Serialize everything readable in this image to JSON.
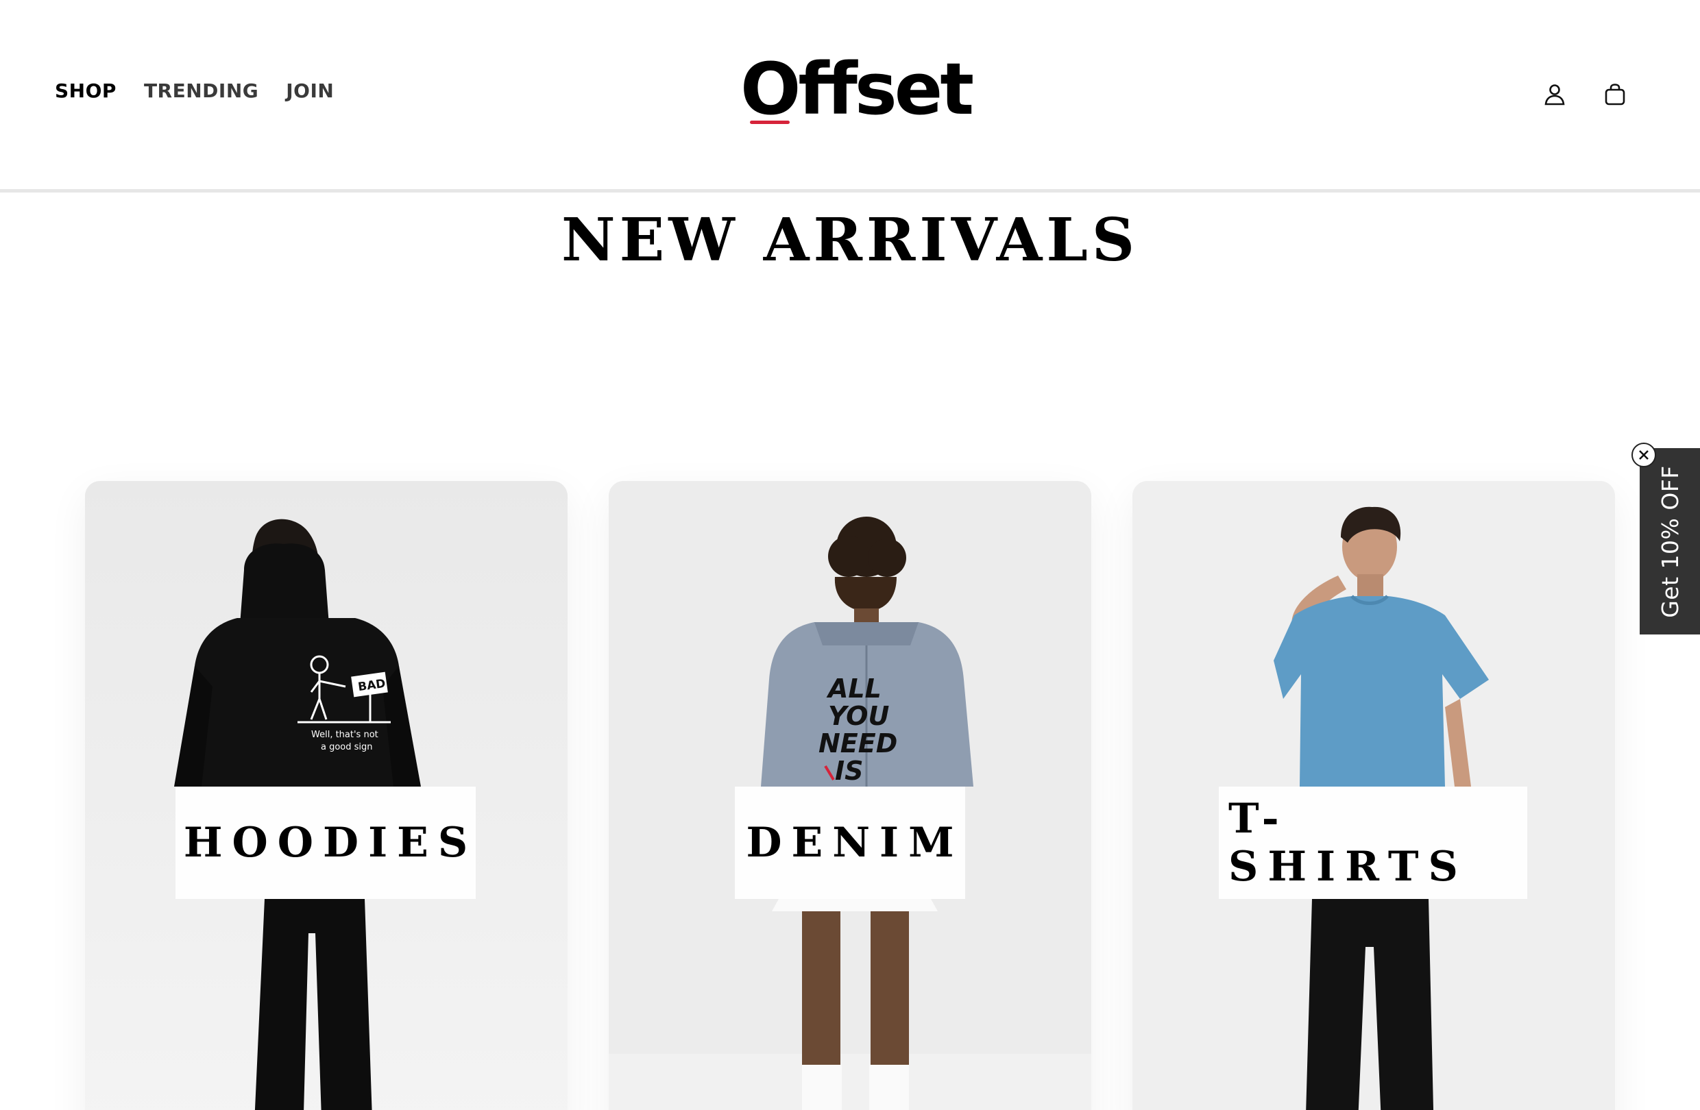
{
  "header": {
    "nav": [
      {
        "label": "SHOP"
      },
      {
        "label": "TRENDING"
      },
      {
        "label": "JOIN"
      }
    ],
    "logo_text": "Offset",
    "icons": {
      "account": "user-icon",
      "cart": "shopping-bag-icon"
    }
  },
  "main": {
    "title": "NEW ARRIVALS",
    "categories": [
      {
        "label": "HOODIES",
        "print_line1": "Well, that's not",
        "print_line2": "a good sign",
        "sign_text": "BAD"
      },
      {
        "label": "DENIM",
        "print_lines": [
          "ALL",
          "YOU",
          "NEED",
          "IS"
        ]
      },
      {
        "label": "T-SHIRTS"
      }
    ]
  },
  "promo": {
    "label": "Get 10% OFF",
    "close_icon": "close-icon"
  },
  "colors": {
    "accent": "#d6233a",
    "promo_bg": "#333333",
    "tshirt": "#5e9cc6"
  }
}
